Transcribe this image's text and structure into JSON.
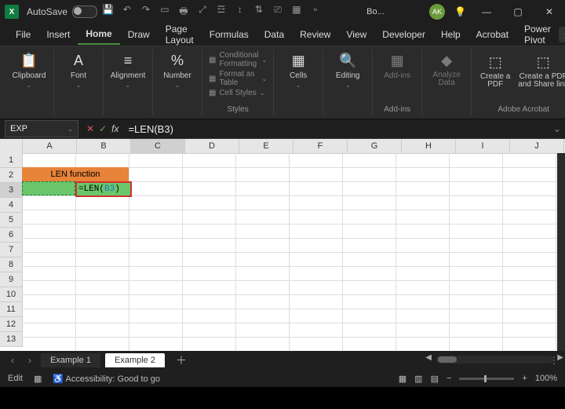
{
  "titlebar": {
    "autosave_label": "AutoSave",
    "autosave_state": "Off",
    "doc_name": "Bo...",
    "avatar": "AK"
  },
  "tabs": {
    "file": "File",
    "insert": "Insert",
    "home": "Home",
    "draw": "Draw",
    "page_layout": "Page Layout",
    "formulas": "Formulas",
    "data": "Data",
    "review": "Review",
    "view": "View",
    "developer": "Developer",
    "help": "Help",
    "acrobat": "Acrobat",
    "power_pivot": "Power Pivot"
  },
  "ribbon": {
    "clipboard": "Clipboard",
    "font": "Font",
    "alignment": "Alignment",
    "number": "Number",
    "cond_fmt": "Conditional Formatting",
    "as_table": "Format as Table",
    "cell_styles": "Cell Styles",
    "styles": "Styles",
    "cells": "Cells",
    "editing": "Editing",
    "addins": "Add-ins",
    "add_ins_label": "Add-ins",
    "analyze": "Analyze Data",
    "create_pdf": "Create a PDF",
    "share_pdf": "Create a PDF and Share link",
    "adobe": "Adobe Acrobat"
  },
  "formula_bar": {
    "name_box": "EXP",
    "formula": "=LEN(B3)"
  },
  "cells": {
    "merged_header": "LEN function",
    "c3_prefix": "=LEN(",
    "c3_ref": "B3",
    "c3_suffix": ")"
  },
  "columns": [
    "A",
    "B",
    "C",
    "D",
    "E",
    "F",
    "G",
    "H",
    "I",
    "J"
  ],
  "rows": [
    "1",
    "2",
    "3",
    "4",
    "5",
    "6",
    "7",
    "8",
    "9",
    "10",
    "11",
    "12",
    "13"
  ],
  "sheet_tabs": {
    "tab1": "Example 1",
    "tab2": "Example 2"
  },
  "status": {
    "mode": "Edit",
    "accessibility": "Accessibility: Good to go",
    "zoom": "100%"
  }
}
